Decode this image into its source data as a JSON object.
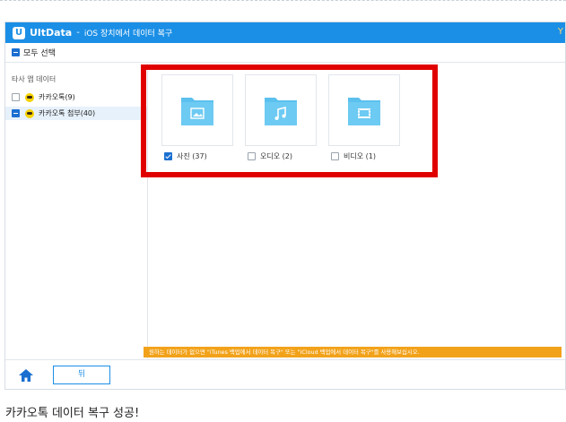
{
  "app": {
    "name": "UltData",
    "separator": "-",
    "subtitle": "iOS 장치에서 데이터 복구"
  },
  "select_all": {
    "label": "모두 선택"
  },
  "sidebar": {
    "title": "타사 앱 데이터",
    "items": [
      {
        "label": "카카오톡(9)",
        "checked": false
      },
      {
        "label": "카카오톡 첨부(40)",
        "checked": "partial"
      }
    ]
  },
  "categories": [
    {
      "label": "사진 (37)",
      "checked": true,
      "icon": "image-folder-icon"
    },
    {
      "label": "오디오 (2)",
      "checked": false,
      "icon": "music-folder-icon"
    },
    {
      "label": "비디오 (1)",
      "checked": false,
      "icon": "video-folder-icon"
    }
  ],
  "notice": "원하는 데이터가 없으면 \"iTunes 백업에서 데이터 복구\" 또는 \"iCloud 백업에서 데이터 복구\"를 사용해보십시오.",
  "footer": {
    "back_label": "뒤"
  },
  "caption": "카카오톡 데이터 복구 성공!",
  "colors": {
    "titlebar": "#1b8fe6",
    "folder": "#5bc0ee",
    "highlight": "#e00000",
    "notice": "#f2a21a"
  }
}
